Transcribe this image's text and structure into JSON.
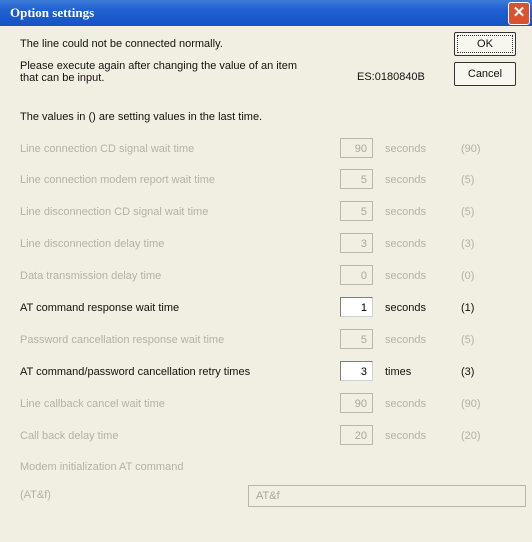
{
  "window": {
    "title": "Option settings"
  },
  "buttons": {
    "ok": "OK",
    "cancel": "Cancel"
  },
  "message": {
    "line1": "The line could not be connected normally.",
    "line2": "Please execute again after changing the value of an item",
    "line3": "that can be input.",
    "code": "ES:0180840B",
    "hint": "The values in () are setting values in the last time."
  },
  "rows": [
    {
      "label": "Line connection CD signal wait time",
      "value": "90",
      "unit": "seconds",
      "last": "(90)",
      "enabled": false
    },
    {
      "label": "Line connection modem report wait time",
      "value": "5",
      "unit": "seconds",
      "last": "(5)",
      "enabled": false
    },
    {
      "label": "Line disconnection CD signal wait time",
      "value": "5",
      "unit": "seconds",
      "last": "(5)",
      "enabled": false
    },
    {
      "label": "Line disconnection delay time",
      "value": "3",
      "unit": "seconds",
      "last": "(3)",
      "enabled": false
    },
    {
      "label": "Data transmission delay time",
      "value": "0",
      "unit": "seconds",
      "last": "(0)",
      "enabled": false
    },
    {
      "label": "AT command response wait time",
      "value": "1",
      "unit": "seconds",
      "last": "(1)",
      "enabled": true
    },
    {
      "label": "Password cancellation response wait time",
      "value": "5",
      "unit": "seconds",
      "last": "(5)",
      "enabled": false
    },
    {
      "label": "AT command/password cancellation retry times",
      "value": "3",
      "unit": "times",
      "last": "(3)",
      "enabled": true
    },
    {
      "label": "Line callback cancel wait time",
      "value": "90",
      "unit": "seconds",
      "last": "(90)",
      "enabled": false
    },
    {
      "label": "Call back delay time",
      "value": "20",
      "unit": "seconds",
      "last": "(20)",
      "enabled": false
    }
  ],
  "modem": {
    "label": "Modem initialization AT command",
    "value": "AT&f",
    "last": "(AT&f)"
  }
}
